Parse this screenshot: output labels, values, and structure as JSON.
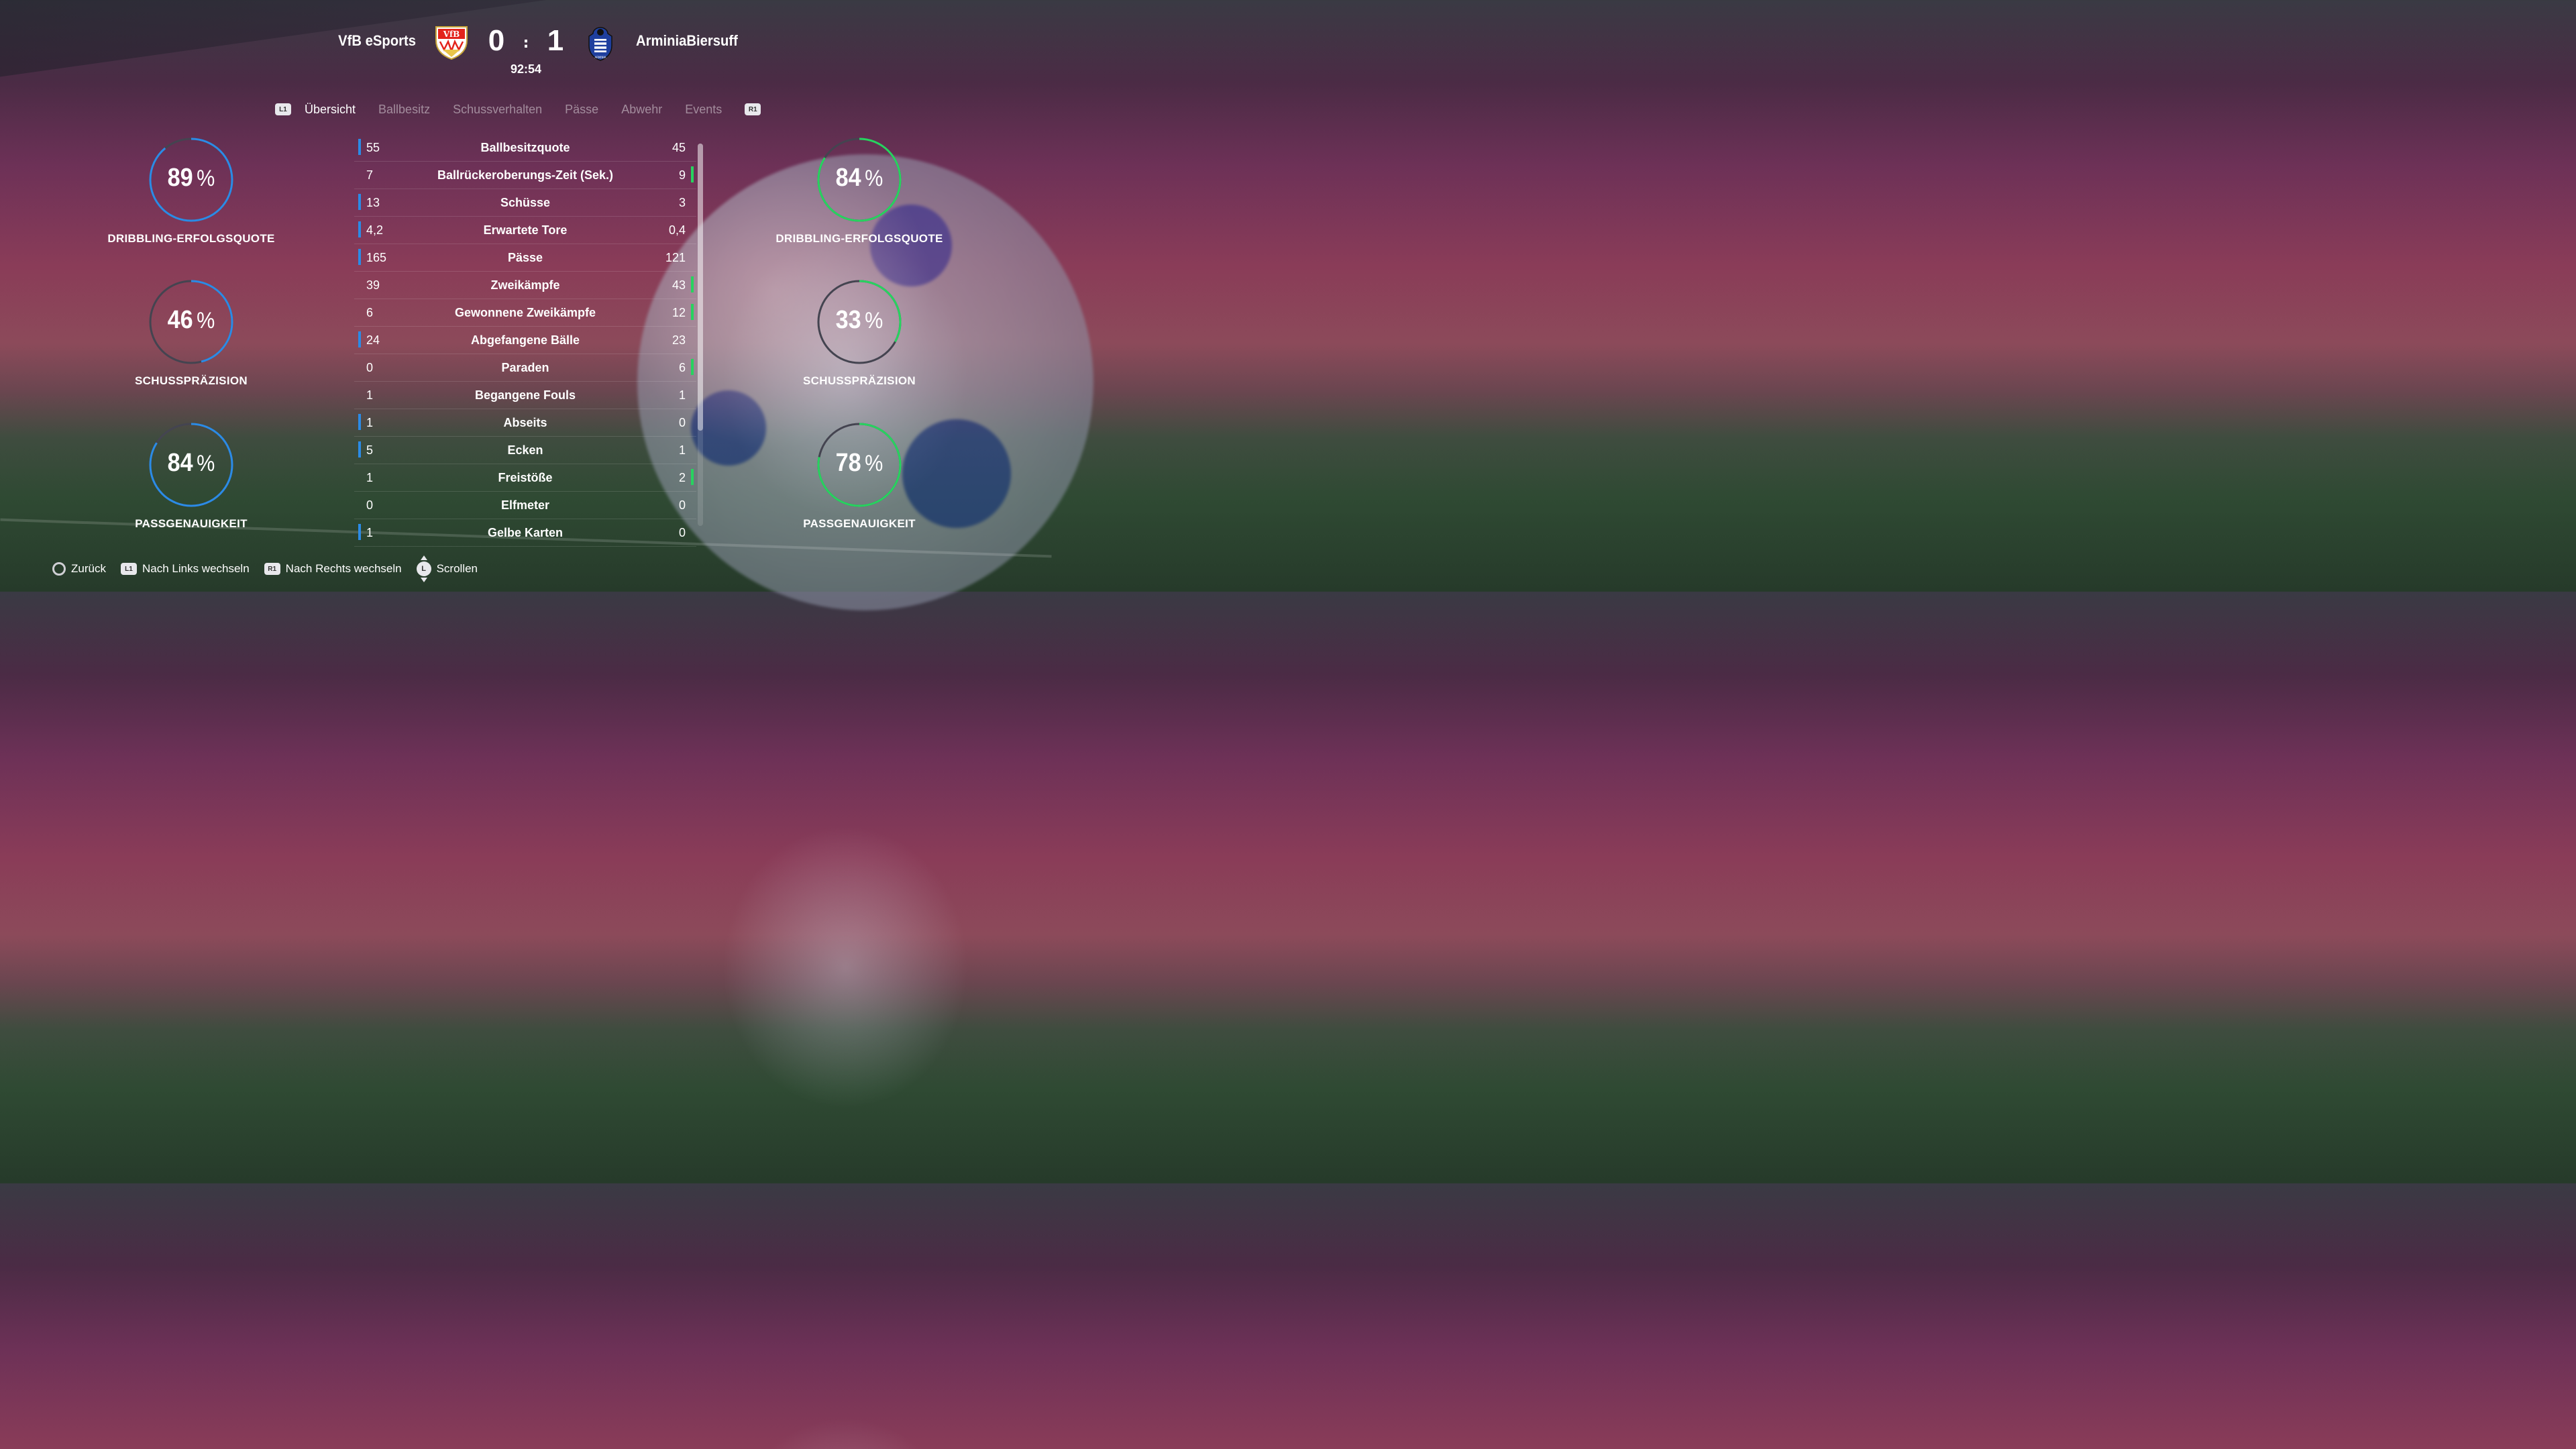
{
  "match": {
    "home_team": "VfB eSports",
    "away_team": "ArminiaBiersuff",
    "home_score": "0",
    "separator": ":",
    "away_score": "1",
    "clock": "92:54",
    "home_crest_text": "VfB",
    "away_crest_text": "ARMINIA"
  },
  "tabs": {
    "left_button": "L1",
    "right_button": "R1",
    "items": [
      "Übersicht",
      "Ballbesitz",
      "Schussverhalten",
      "Pässe",
      "Abwehr",
      "Events"
    ],
    "active_index": 0
  },
  "colors": {
    "home": "#2b8be6",
    "away": "#27d35f",
    "track": "#444450"
  },
  "gauges": {
    "home": [
      {
        "value": "89",
        "unit": "%",
        "label": "DRIBBLING-ERFOLGSQUOTE",
        "fraction": 0.89
      },
      {
        "value": "46",
        "unit": "%",
        "label": "SCHUSSPRÄZISION",
        "fraction": 0.46
      },
      {
        "value": "84",
        "unit": "%",
        "label": "PASSGENAUIGKEIT",
        "fraction": 0.84
      }
    ],
    "away": [
      {
        "value": "84",
        "unit": "%",
        "label": "DRIBBLING-ERFOLGSQUOTE",
        "fraction": 0.84
      },
      {
        "value": "33",
        "unit": "%",
        "label": "SCHUSSPRÄZISION",
        "fraction": 0.33
      },
      {
        "value": "78",
        "unit": "%",
        "label": "PASSGENAUIGKEIT",
        "fraction": 0.78
      }
    ]
  },
  "stats": [
    {
      "home": "55",
      "name": "Ballbesitzquote",
      "away": "45",
      "lead": "home"
    },
    {
      "home": "7",
      "name": "Ballrückeroberungs-Zeit (Sek.)",
      "away": "9",
      "lead": "away"
    },
    {
      "home": "13",
      "name": "Schüsse",
      "away": "3",
      "lead": "home"
    },
    {
      "home": "4,2",
      "name": "Erwartete Tore",
      "away": "0,4",
      "lead": "home"
    },
    {
      "home": "165",
      "name": "Pässe",
      "away": "121",
      "lead": "home"
    },
    {
      "home": "39",
      "name": "Zweikämpfe",
      "away": "43",
      "lead": "away"
    },
    {
      "home": "6",
      "name": "Gewonnene Zweikämpfe",
      "away": "12",
      "lead": "away"
    },
    {
      "home": "24",
      "name": "Abgefangene Bälle",
      "away": "23",
      "lead": "home"
    },
    {
      "home": "0",
      "name": "Paraden",
      "away": "6",
      "lead": "away"
    },
    {
      "home": "1",
      "name": "Begangene Fouls",
      "away": "1",
      "lead": "none"
    },
    {
      "home": "1",
      "name": "Abseits",
      "away": "0",
      "lead": "home"
    },
    {
      "home": "5",
      "name": "Ecken",
      "away": "1",
      "lead": "home"
    },
    {
      "home": "1",
      "name": "Freistöße",
      "away": "2",
      "lead": "away"
    },
    {
      "home": "0",
      "name": "Elfmeter",
      "away": "0",
      "lead": "none"
    },
    {
      "home": "1",
      "name": "Gelbe Karten",
      "away": "0",
      "lead": "home"
    }
  ],
  "footer": {
    "back": "Zurück",
    "l1_badge": "L1",
    "left": "Nach Links wechseln",
    "r1_badge": "R1",
    "right": "Nach Rechts wechseln",
    "stick_badge": "L",
    "scroll": "Scrollen"
  }
}
